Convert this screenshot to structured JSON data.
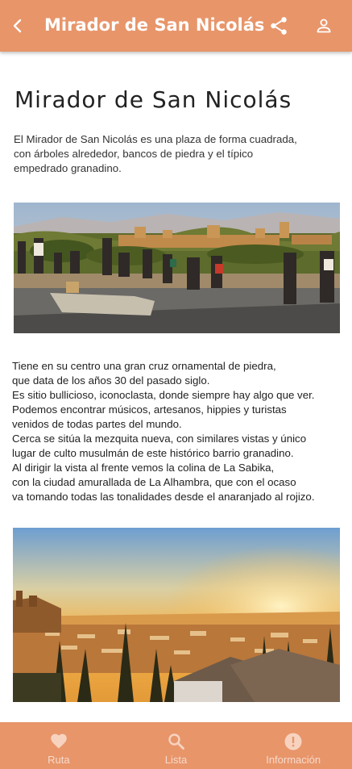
{
  "colors": {
    "primary": "#E8956A",
    "nav_icon": "#f7d3bf"
  },
  "appbar": {
    "title": "Mirador de San Nicolás",
    "back_icon": "chevron-left-icon",
    "share_icon": "share-icon",
    "account_icon": "person-icon"
  },
  "article": {
    "heading": "Mirador de San Nicolás",
    "intro_lines": [
      "El Mirador de San Nicolás es una plaza de forma cuadrada,",
      "con árboles alrededor, bancos de piedra y el típico",
      "empedrado granadino."
    ],
    "body_lines": [
      "Tiene en su centro una gran cruz ornamental de piedra,",
      "que data de los años 30 del pasado siglo.",
      "Es sitio bullicioso, iconoclasta, donde siempre hay algo que ver.",
      "Podemos encontrar músicos, artesanos, hippies y turistas",
      "venidos de todas partes del mundo.",
      "Cerca se sitúa la mezquita nueva, con similares vistas y único",
      "lugar de culto musulmán de este histórico barrio granadino.",
      "Al dirigir la vista al frente vemos la colina de La Sabika,",
      "con la ciudad amurallada de La Alhambra, que con el ocaso",
      "va tomando todas las tonalidades desde el anaranjado al rojizo."
    ]
  },
  "bottom_nav": {
    "items": [
      {
        "label": "Ruta",
        "icon": "heart-icon"
      },
      {
        "label": "Lista",
        "icon": "search-icon"
      },
      {
        "label": "Información",
        "icon": "info-alert-icon"
      }
    ]
  }
}
